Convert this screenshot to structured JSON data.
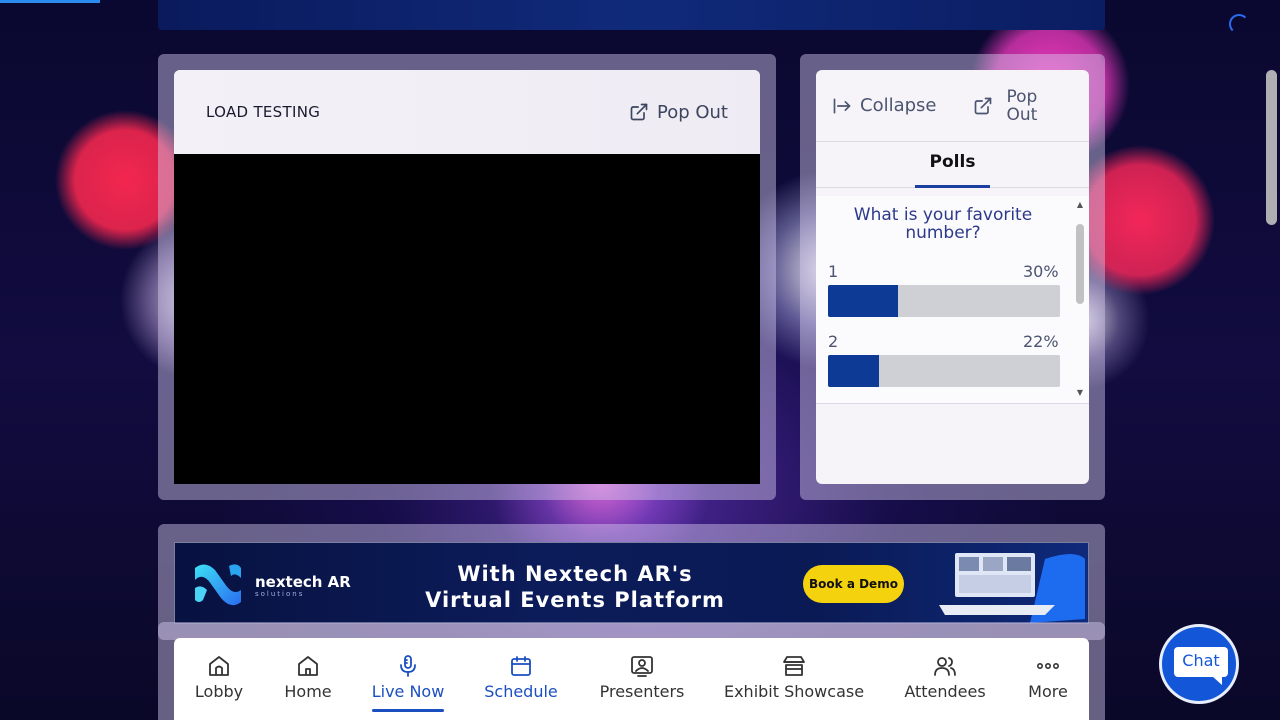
{
  "video": {
    "title": "LOAD TESTING",
    "popout_label": "Pop Out"
  },
  "side_panel": {
    "collapse_label": "Collapse",
    "popout_line1": "Pop",
    "popout_line2": "Out",
    "tab_polls": "Polls",
    "poll": {
      "question": "What is your favorite number?",
      "options": [
        {
          "label": "1",
          "percent_text": "30%",
          "percent": 30
        },
        {
          "label": "2",
          "percent_text": "22%",
          "percent": 22
        }
      ]
    }
  },
  "ad": {
    "brand": "nextech AR",
    "brand_sub": "solutions",
    "tagline_line1": "With Nextech AR's",
    "tagline_line2": "Virtual Events Platform",
    "cta": "Book a Demo"
  },
  "nav": {
    "items": [
      {
        "label": "Lobby",
        "icon": "lobby-icon"
      },
      {
        "label": "Home",
        "icon": "home-icon"
      },
      {
        "label": "Live Now",
        "icon": "microphone-icon",
        "active": true
      },
      {
        "label": "Schedule",
        "icon": "calendar-icon"
      },
      {
        "label": "Presenters",
        "icon": "presenter-icon"
      },
      {
        "label": "Exhibit Showcase",
        "icon": "booth-icon"
      },
      {
        "label": "Attendees",
        "icon": "attendees-icon"
      },
      {
        "label": "More",
        "icon": "more-icon"
      }
    ]
  },
  "chat": {
    "label": "Chat"
  },
  "colors": {
    "accent": "#1b4fc0",
    "poll_bar": "#0d3a94",
    "cta_yellow": "#f5d20e"
  }
}
